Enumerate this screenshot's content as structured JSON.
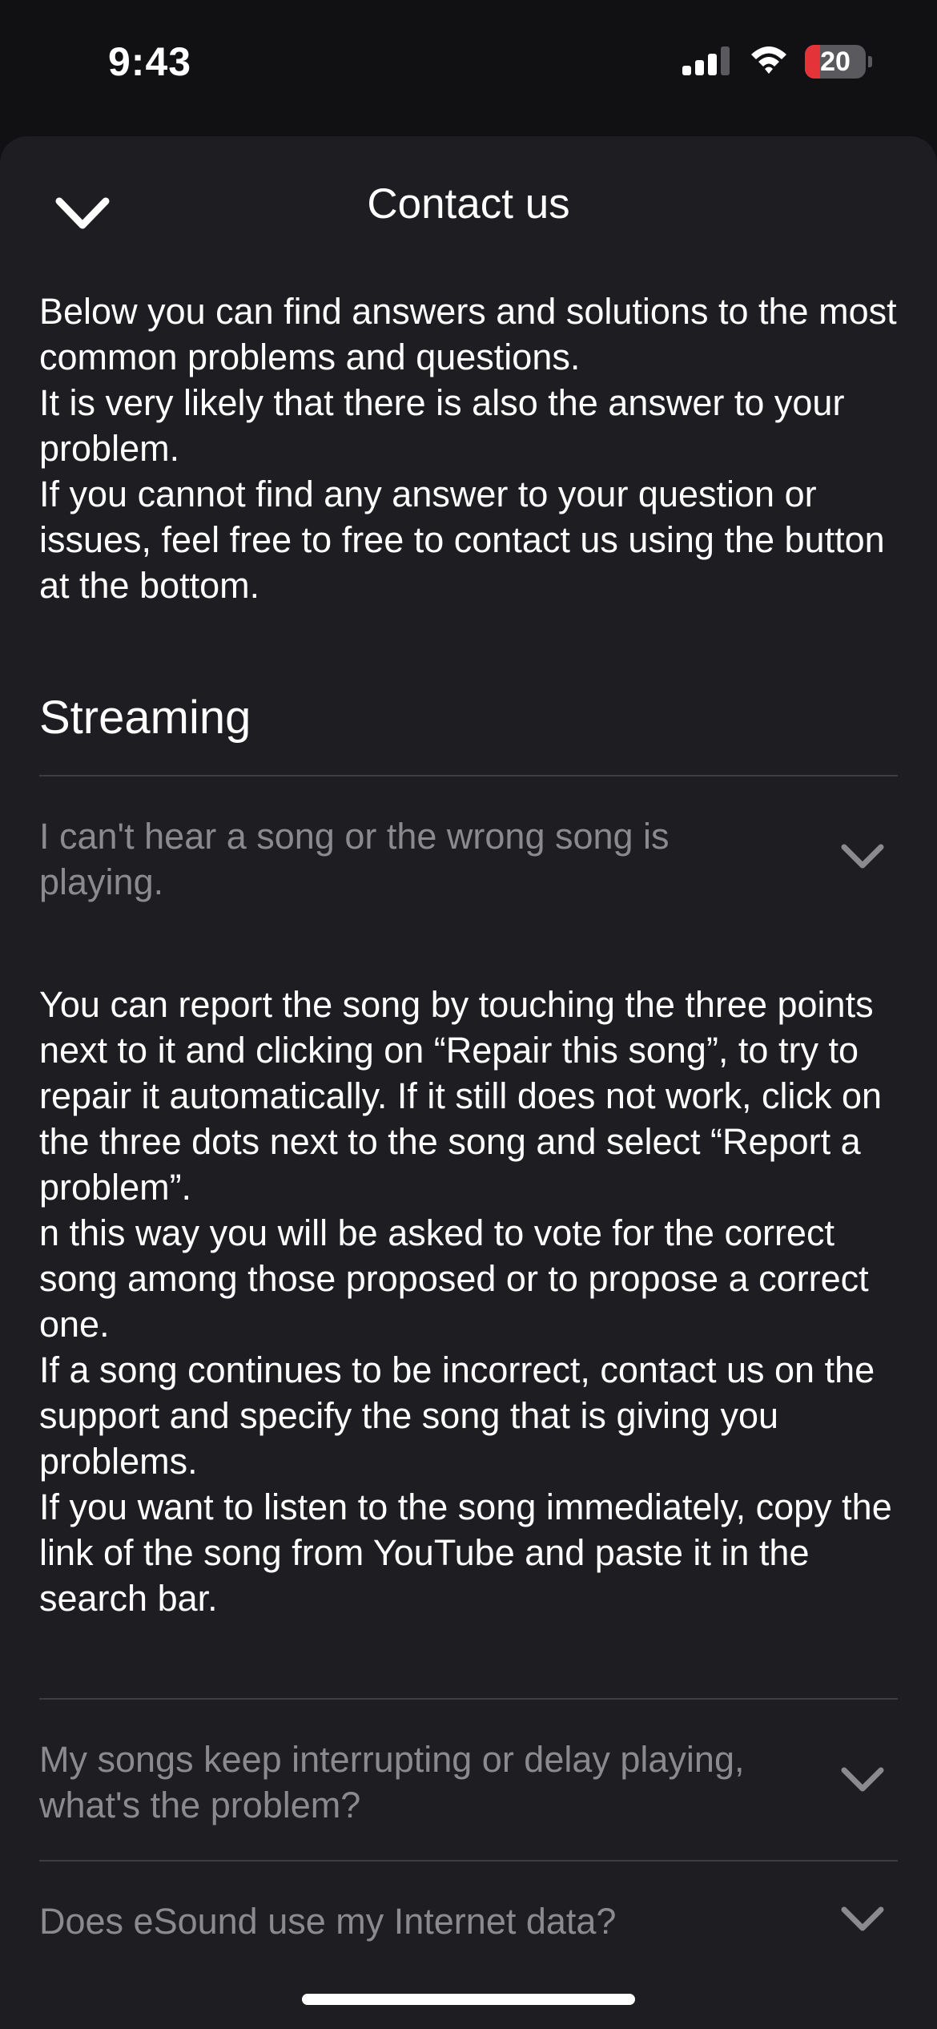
{
  "status_bar": {
    "time": "9:43",
    "battery_level": "20",
    "battery_fraction": 0.2
  },
  "header": {
    "title": "Contact us",
    "collapse_icon": "chevron-down-icon"
  },
  "intro": {
    "paragraphs": [
      "Below you can find answers and solutions to the most common problems and questions.",
      "It is very likely that there is also the answer to your problem.",
      "If you cannot find any answer to your question or issues, feel free to free to contact us using the button at the bottom."
    ]
  },
  "section": {
    "title": "Streaming"
  },
  "faq": [
    {
      "question": "I can't hear a song or the wrong song is playing.",
      "expanded": true,
      "answer": [
        "You can report the song by touching the three points next to it and clicking on “Repair this song”, to try to repair it automatically. If it still does not work, click on the three dots next to the song and select “Report a problem”.",
        "n this way you will be asked to vote for the correct song among those proposed or to propose a correct one.",
        "If a song continues to be incorrect, contact us on the support and specify the song that is giving you problems.",
        "If you want to listen to the song immediately, copy the link of the song from YouTube and paste it in the search bar."
      ]
    },
    {
      "question": "My songs keep interrupting or delay playing, what's the problem?",
      "expanded": false
    },
    {
      "question": "Does eSound use my Internet data?",
      "expanded": false
    }
  ],
  "colors": {
    "background": "#111114",
    "sheet": "#1e1e22",
    "divider": "#3d3d42",
    "muted_text": "#8a8a8f",
    "battery_low": "#e5333a"
  }
}
